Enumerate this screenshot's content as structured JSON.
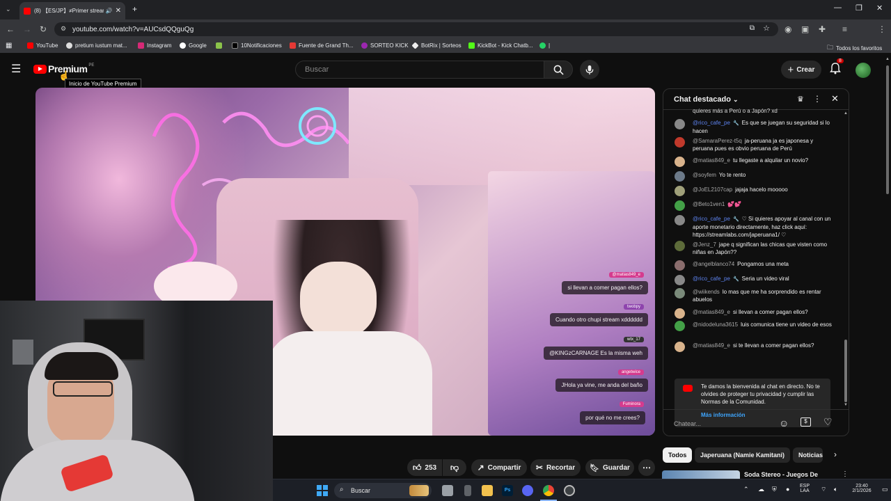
{
  "browser": {
    "tab_title": "(8) 【ES/JP】≠Primer stream",
    "url": "youtube.com/watch?v=AUCsdQQguQg",
    "bookmarks": [
      "YouTube",
      "pretium iustum mat...",
      "Instagram",
      "Google",
      "10Notificaciones",
      "Fuente de Grand Th...",
      "SORTEO KICK",
      "BotRix | Sorteos",
      "KickBot - Kick Chatb...",
      "|"
    ],
    "bookmarks_folder": "Todos los favoritos"
  },
  "youtube": {
    "logo_text": "Premium",
    "logo_region": "PE",
    "tooltip": "Inicio de YouTube Premium",
    "search_placeholder": "Buscar",
    "create_label": "Crear",
    "notif_count": "8"
  },
  "video_overlay_chat": [
    {
      "user": "@matias849_e",
      "text": "si llevan a comer pagan ellos?"
    },
    {
      "user": "twobpy",
      "text": "Cuando otro chupi stream xdddddd"
    },
    {
      "user": "wtx_17",
      "text": "@KINGzCARNAGE Es la misma weh"
    },
    {
      "user": "angetwice",
      "text": "JHola ya vine, me anda del baño"
    },
    {
      "user": "Fuminora",
      "text": "por qué no me crees?"
    }
  ],
  "chat": {
    "title": "Chat destacado",
    "top_partial": "quieres más a Perú o a Japón? xd",
    "messages": [
      {
        "author": "@rico_cafe_pe",
        "mod": true,
        "text": "Es que se juegan su seguridad si lo hacen",
        "color": "#888888"
      },
      {
        "author": "@SamaraPerez-t5q",
        "mod": false,
        "text": "ja-peruana ja es japonesa y peruana pues es obvio peruana de Perú",
        "color": "#c0392b"
      },
      {
        "author": "@matias849_e",
        "mod": false,
        "text": "tu llegaste a alquilar un novio?",
        "color": "#d9b38c"
      },
      {
        "author": "@soyfem",
        "mod": false,
        "text": "Yo te rento",
        "color": "#6c7a89"
      },
      {
        "author": "@JoEL2107cap",
        "mod": false,
        "text": "jajaja hacelo mooooo",
        "color": "#a0a07a"
      },
      {
        "author": "@Beto1ven1",
        "mod": false,
        "text": "💕💕",
        "color": "#43a047"
      },
      {
        "author": "@rico_cafe_pe",
        "mod": true,
        "text": "♡ Si quieres apoyar al canal con un aporte monetario directamente, haz click aquí: https://streamlabs.com/japeruana1/ ♡",
        "color": "#888888"
      },
      {
        "author": "@Jenz_7",
        "mod": false,
        "text": "jape q significan las chicas que visten como niñas en Japón??",
        "color": "#5d6b3a"
      },
      {
        "author": "@angelblanco74",
        "mod": false,
        "text": "Pongamos una meta",
        "color": "#8a6d6d"
      },
      {
        "author": "@rico_cafe_pe",
        "mod": true,
        "text": "Seria un video viral",
        "color": "#888888"
      },
      {
        "author": "@wiikends",
        "mod": false,
        "text": "lo mas que me ha sorprendido es rentar abuelos",
        "color": "#7a8a7a"
      },
      {
        "author": "@matias849_e",
        "mod": false,
        "text": "si llevan a comer pagan ellos?",
        "color": "#d9b38c"
      },
      {
        "author": "@nidodeluna3615",
        "mod": false,
        "text": "luis comunica tiene un video de esos",
        "color": "#43a047"
      },
      {
        "author": "@matias849_e",
        "mod": false,
        "text": "si te llevan a comer pagan ellos?",
        "color": "#d9b38c"
      }
    ],
    "welcome_text": "Te damos la bienvenida al chat en directo. No te olvides de proteger tu privacidad y cumplir las Normas de la Comunidad.",
    "welcome_link": "Más información",
    "input_placeholder": "Chatear..."
  },
  "actions": {
    "likes": "253",
    "share": "Compartir",
    "clip": "Recortar",
    "save": "Guardar"
  },
  "chips": [
    "Todos",
    "Japeruana (Namie Kamitani)",
    "Noticias"
  ],
  "related_title": "Soda Stereo - Juegos De",
  "taskbar": {
    "search": "Buscar",
    "lang": "ESP",
    "lang2": "LAA",
    "time": "23:40",
    "date": "2/1/2026"
  }
}
